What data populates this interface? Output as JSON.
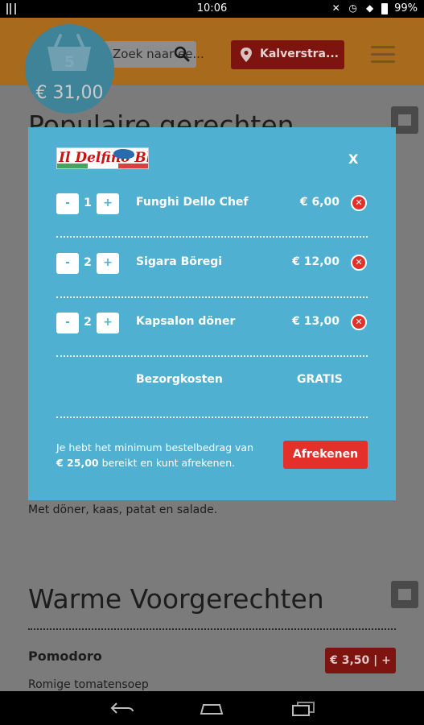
{
  "status_bar": {
    "time": "10:06",
    "battery": "99%"
  },
  "header": {
    "search_placeholder": "Zoek naar ee...",
    "location": "Kalverstra...",
    "basket_count": "5",
    "basket_total": "€ 31,00"
  },
  "background": {
    "section1_title": "Populaire gerechten",
    "dish_desc": "Met döner, kaas, patat en salade.",
    "section2_title": "Warme Voorgerechten",
    "dish2_name": "Pomodoro",
    "dish2_price": "€ 3,50 | +",
    "dish2_desc": "Romige tomatensoep"
  },
  "cart": {
    "restaurant": "Il Delfino Blu",
    "close_label": "X",
    "items": [
      {
        "qty": "1",
        "name": "Funghi Dello Chef",
        "price": "€ 6,00"
      },
      {
        "qty": "2",
        "name": "Sigara Böregi",
        "price": "€ 12,00"
      },
      {
        "qty": "2",
        "name": "Kapsalon döner",
        "price": "€ 13,00"
      }
    ],
    "minus_label": "-",
    "plus_label": "+",
    "delivery_label": "Bezorgkosten",
    "delivery_value": "GRATIS",
    "min_msg_1": "Je hebt het minimum bestelbedrag van",
    "min_amount": "€ 25,00",
    "min_msg_2": " bereikt en kunt afrekenen.",
    "checkout_label": "Afrekenen"
  },
  "colors": {
    "header": "#a86a1c",
    "modal": "#4fb0d1",
    "accent_red": "#e3302a",
    "basket": "#3f8398"
  }
}
